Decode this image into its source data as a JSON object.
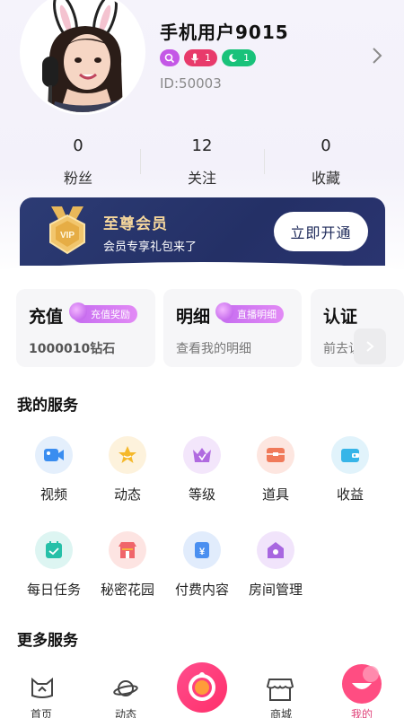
{
  "profile": {
    "username": "手机用户9015",
    "user_id": "ID:50003",
    "badges": [
      {
        "icon": "search-icon",
        "value": "",
        "color": "#c458e6"
      },
      {
        "icon": "mic-icon",
        "value": "1",
        "color": "#e83a6b"
      },
      {
        "icon": "moon-icon",
        "value": "1",
        "color": "#19c27a"
      }
    ]
  },
  "stats": [
    {
      "value": "0",
      "label": "粉丝"
    },
    {
      "value": "12",
      "label": "关注"
    },
    {
      "value": "0",
      "label": "收藏"
    }
  ],
  "vip": {
    "title": "至尊会员",
    "subtitle": "会员专享礼包来了",
    "button": "立即开通",
    "medal_text": "VIP"
  },
  "cards": [
    {
      "title": "充值",
      "tag": "充值奖励",
      "desc": "1000010钻石"
    },
    {
      "title": "明细",
      "tag": "直播明细",
      "desc": "查看我的明细"
    },
    {
      "title": "认证",
      "desc": "前去认证"
    }
  ],
  "my_services": {
    "title": "我的服务",
    "items": [
      {
        "label": "视频",
        "icon": "video-icon"
      },
      {
        "label": "动态",
        "icon": "moments-icon"
      },
      {
        "label": "等级",
        "icon": "level-icon"
      },
      {
        "label": "道具",
        "icon": "props-icon"
      },
      {
        "label": "收益",
        "icon": "wallet-icon"
      },
      {
        "label": "每日任务",
        "icon": "daily-task-icon"
      },
      {
        "label": "秘密花园",
        "icon": "garden-icon"
      },
      {
        "label": "付费内容",
        "icon": "paid-content-icon"
      },
      {
        "label": "房间管理",
        "icon": "room-manage-icon"
      }
    ]
  },
  "more_services": {
    "title": "更多服务"
  },
  "tabbar": {
    "items": [
      {
        "label": "首页",
        "icon": "home-icon"
      },
      {
        "label": "动态",
        "icon": "planet-icon"
      },
      {
        "label": "",
        "icon": "live-camera-icon"
      },
      {
        "label": "商城",
        "icon": "shop-icon"
      },
      {
        "label": "我的",
        "icon": "profile-smile-icon",
        "active": true
      }
    ]
  },
  "colors": {
    "accent": "#e0437a",
    "vip_bg": "#2a3670",
    "vip_gold": "#f6d79c"
  }
}
